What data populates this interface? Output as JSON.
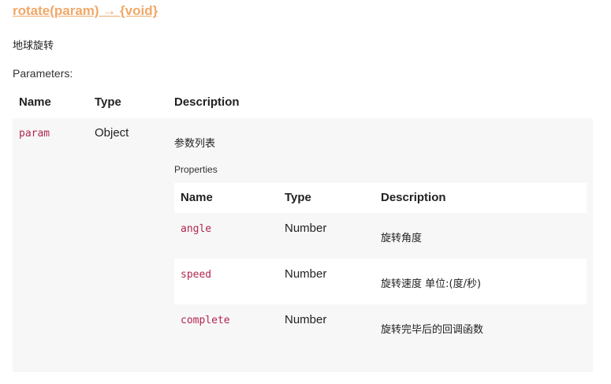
{
  "method": {
    "title": "rotate(param) → {void}",
    "description": "地球旋转"
  },
  "parameters_label": "Parameters:",
  "outer_table": {
    "headers": {
      "name": "Name",
      "type": "Type",
      "description": "Description"
    },
    "row": {
      "name": "param",
      "type": "Object",
      "description": "参数列表",
      "properties_label": "Properties"
    }
  },
  "inner_table": {
    "headers": {
      "name": "Name",
      "type": "Type",
      "description": "Description"
    },
    "rows": [
      {
        "name": "angle",
        "type": "Number",
        "description": "旋转角度"
      },
      {
        "name": "speed",
        "type": "Number",
        "description": "旋转速度 单位:(度/秒)"
      },
      {
        "name": "complete",
        "type": "Number",
        "description": "旋转完毕后的回调函数"
      }
    ]
  },
  "colors": {
    "title": "#f0a868",
    "code": "#b2274f",
    "stripe": "#f7f7f7"
  }
}
